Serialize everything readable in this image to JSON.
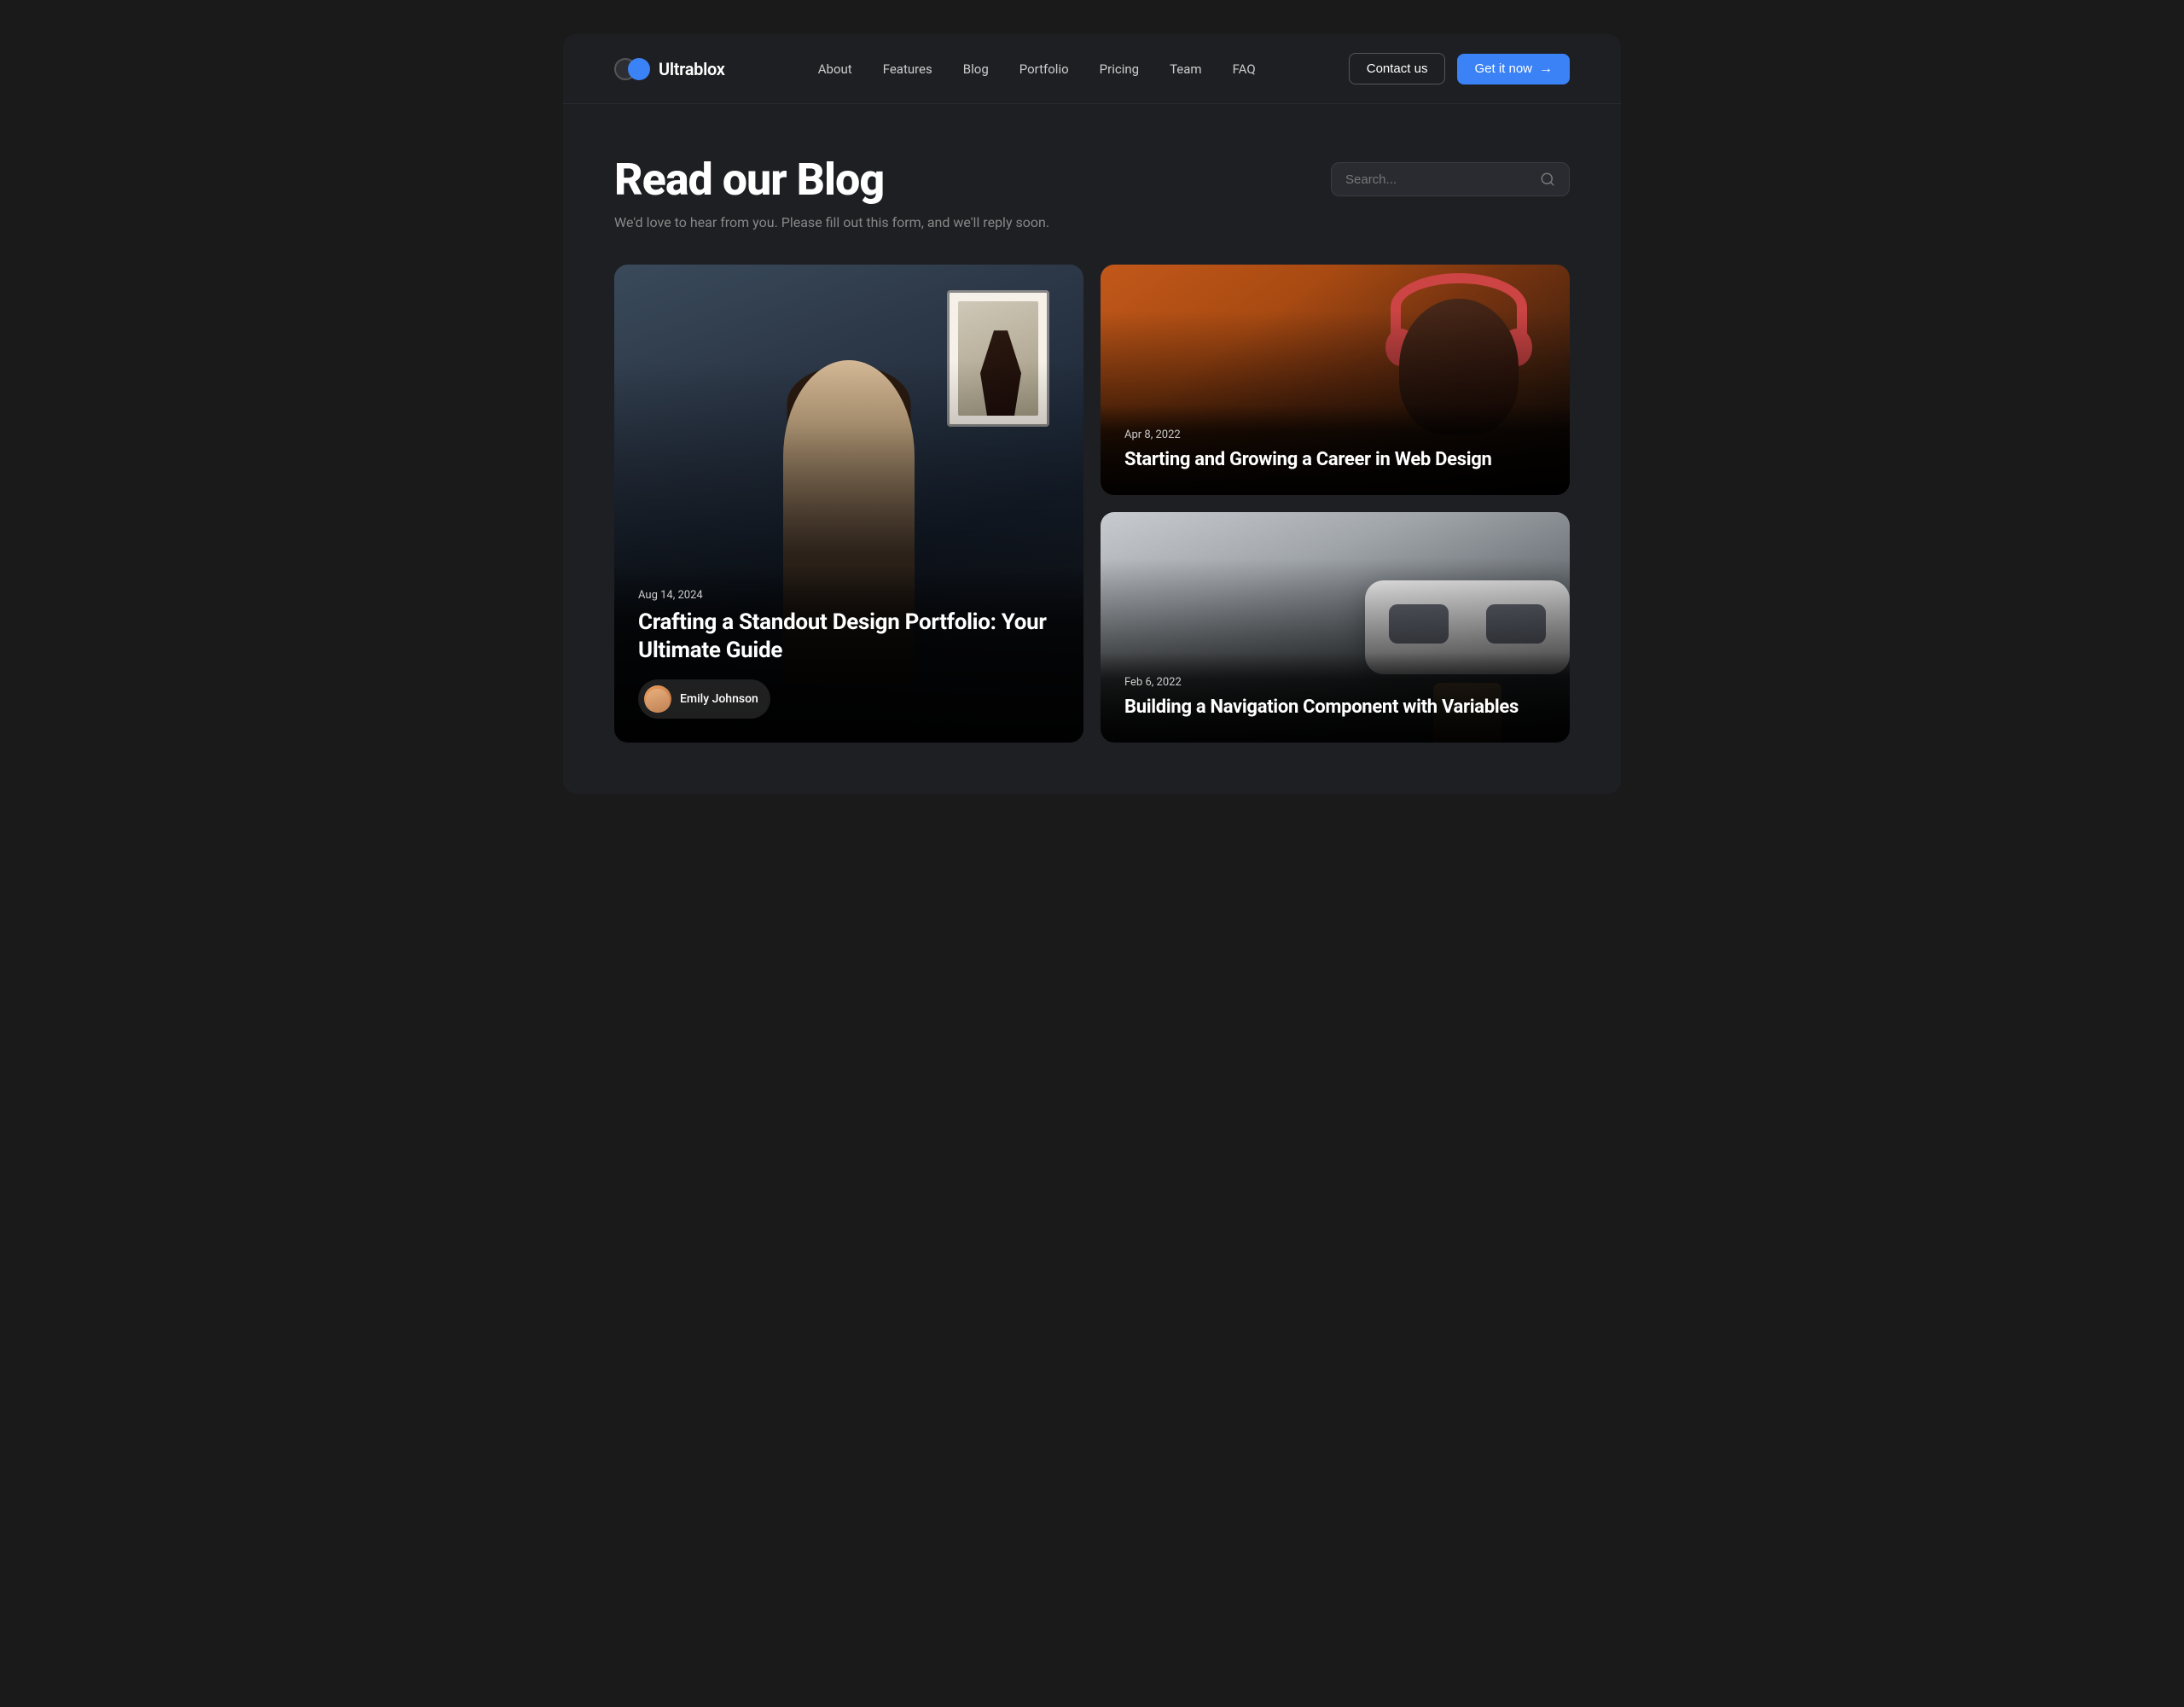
{
  "brand": {
    "name": "Ultrablox"
  },
  "nav": {
    "links": [
      {
        "label": "About",
        "id": "about"
      },
      {
        "label": "Features",
        "id": "features"
      },
      {
        "label": "Blog",
        "id": "blog"
      },
      {
        "label": "Portfolio",
        "id": "portfolio"
      },
      {
        "label": "Pricing",
        "id": "pricing"
      },
      {
        "label": "Team",
        "id": "team"
      },
      {
        "label": "FAQ",
        "id": "faq"
      }
    ],
    "contact_label": "Contact us",
    "cta_label": "Get it now"
  },
  "hero": {
    "title": "Read our Blog",
    "subtitle": "We'd love to hear from you. Please fill out this form, and we'll reply soon.",
    "search_placeholder": "Search..."
  },
  "posts": [
    {
      "id": "post-1",
      "date": "Aug 14, 2024",
      "title": "Crafting a Standout Design Portfolio: Your Ultimate Guide",
      "author": "Emily Johnson",
      "size": "large"
    },
    {
      "id": "post-2",
      "date": "Apr 8, 2022",
      "title": "Starting and Growing a Career in Web Design",
      "size": "small"
    },
    {
      "id": "post-3",
      "date": "Feb 6, 2022",
      "title": "Building a Navigation Component with Variables",
      "size": "small"
    }
  ]
}
